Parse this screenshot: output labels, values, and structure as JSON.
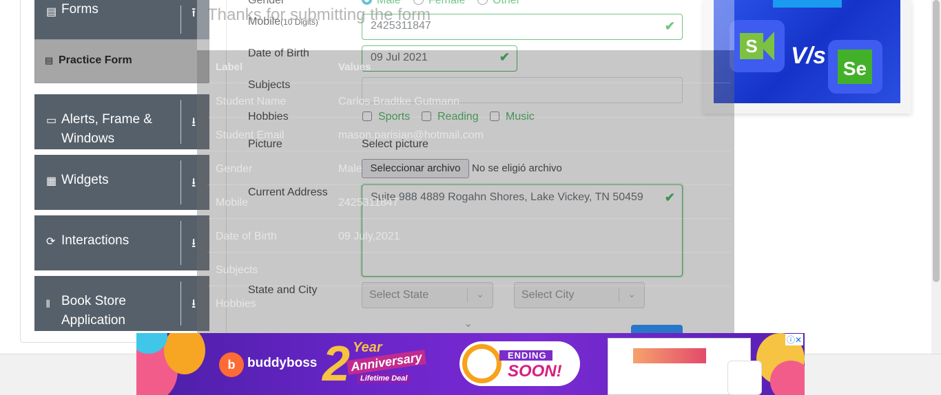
{
  "nav": {
    "forms": "Forms",
    "practice_form": "Practice Form",
    "alerts_line1": "Alerts, Frame &",
    "alerts_line2": "Windows",
    "widgets": "Widgets",
    "interactions": "Interactions",
    "bookstore_line1": "Book Store",
    "bookstore_line2": "Application"
  },
  "form": {
    "gender_label": "Gender",
    "gender_options": [
      "Male",
      "Female",
      "Other"
    ],
    "mobile_label": "Mobile",
    "mobile_hint": "(10 Digits)",
    "mobile_value": "2425311847",
    "dob_label": "Date of Birth",
    "dob_value": "09 Jul 2021",
    "subjects_label": "Subjects",
    "hobbies_label": "Hobbies",
    "hobbies": [
      "Sports",
      "Reading",
      "Music"
    ],
    "picture_label": "Picture",
    "select_picture": "Select picture",
    "file_button": "Seleccionar archivo",
    "file_status": "No se eligió archivo",
    "address_label": "Current Address",
    "address_value": "Suite 988 4889 Rogahn Shores, Lake Vickey, TN 50459",
    "state_city_label": "State and City",
    "state_placeholder": "Select State",
    "city_placeholder": "Select City"
  },
  "modal": {
    "title": "Thanks for submitting the form",
    "col_label": "Label",
    "col_values": "Values",
    "rows": [
      {
        "label": "Student Name",
        "value": "Carlos Bradtke Gutmann"
      },
      {
        "label": "Student Email",
        "value": "mason.parisian@hotmail.com"
      },
      {
        "label": "Gender",
        "value": "Male"
      },
      {
        "label": "Mobile",
        "value": "2425311847"
      },
      {
        "label": "Date of Birth",
        "value": "09 July,2021"
      },
      {
        "label": "Subjects",
        "value": ""
      },
      {
        "label": "Hobbies",
        "value": ""
      }
    ]
  },
  "ads": {
    "vs": "V/s",
    "brand": "buddyboss",
    "year": "Year",
    "anniversary": "Anniversary",
    "lifetime": "Lifetime Deal",
    "ending": "ENDING",
    "soon": "SOON!",
    "two": "2"
  },
  "colors": {
    "nav_bg": "#56606a",
    "valid_green": "#28a745",
    "primary_blue": "#007bff"
  }
}
